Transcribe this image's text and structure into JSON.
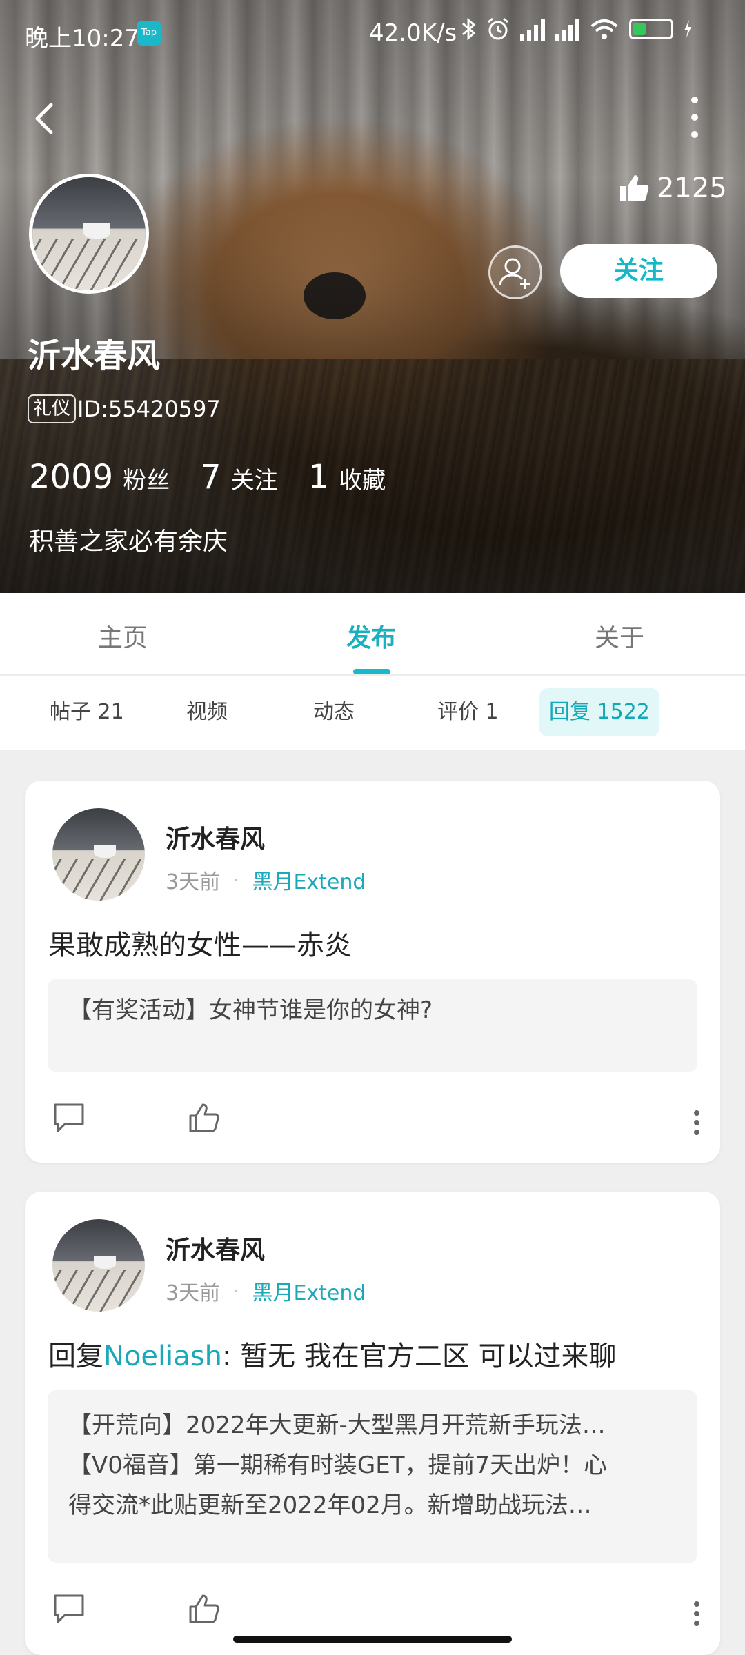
{
  "status_bar": {
    "time": "晚上10:27",
    "app_badge": "Tap",
    "network_speed": "42.0K/s",
    "battery_level": "5"
  },
  "profile": {
    "likes_count": "2125",
    "name": "沂水春风",
    "tag": "礼仪",
    "id_text": "ID:55420597",
    "stats": [
      {
        "value": "2009",
        "label": "粉丝"
      },
      {
        "value": "7",
        "label": "关注"
      },
      {
        "value": "1",
        "label": "收藏"
      }
    ],
    "bio": "积善之家必有余庆",
    "follow_label": "关注"
  },
  "main_tabs": [
    {
      "label": "主页",
      "active": false
    },
    {
      "label": "发布",
      "active": true
    },
    {
      "label": "关于",
      "active": false
    }
  ],
  "sub_tabs": [
    {
      "label": "帖子 21",
      "active": false
    },
    {
      "label": "视频",
      "active": false
    },
    {
      "label": "动态",
      "active": false
    },
    {
      "label": "评价 1",
      "active": false
    },
    {
      "label": "回复 1522",
      "active": true
    }
  ],
  "posts": [
    {
      "author": "沂水春风",
      "time": "3天前",
      "group": "黑月Extend",
      "content": "果敢成熟的女性——赤炎",
      "quote_lines": [
        "【有奖活动】女神节谁是你的女神?"
      ]
    },
    {
      "author": "沂水春风",
      "time": "3天前",
      "group": "黑月Extend",
      "reply_prefix": "回复",
      "reply_mention": "Noeliash",
      "content": ": 暂无 我在官方二区 可以过来聊",
      "quote_lines": [
        "【开荒向】2022年大更新-大型黑月开荒新手玩法…",
        "【V0福音】第一期稀有时装GET，提前7天出炉！心",
        "得交流*此贴更新至2022年02月。新增助战玩法…"
      ]
    }
  ],
  "colors": {
    "accent": "#1ab8c9",
    "accent_text": "#1aa9b8",
    "active_subtab_bg": "#e2f7f8"
  }
}
